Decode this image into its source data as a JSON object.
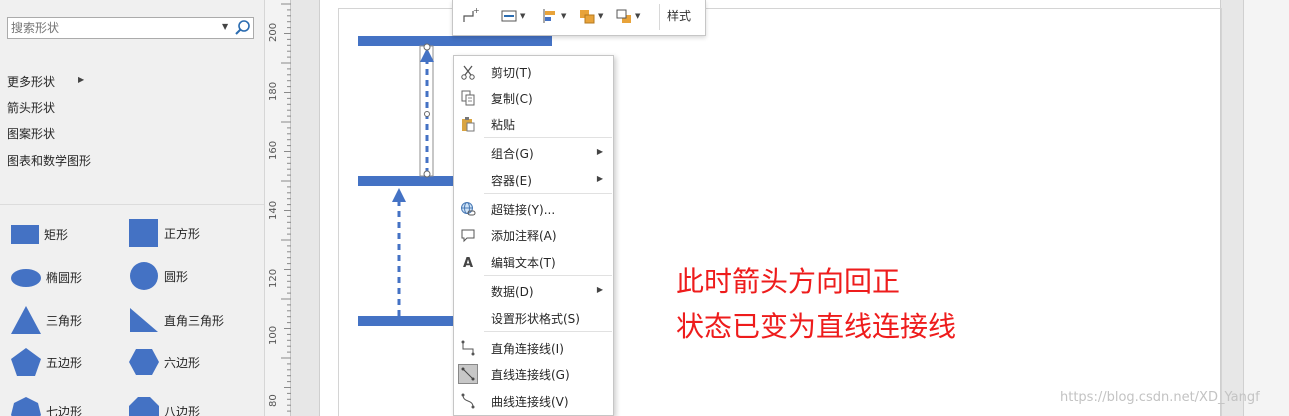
{
  "shapes_panel": {
    "search": {
      "placeholder": "搜索形状"
    },
    "categories": [
      "更多形状",
      "箭头形状",
      "图案形状",
      "图表和数学图形"
    ],
    "shapes": [
      "矩形",
      "正方形",
      "椭圆形",
      "圆形",
      "三角形",
      "直角三角形",
      "五边形",
      "六边形",
      "七边形",
      "八边形"
    ]
  },
  "ruler": {
    "labels": [
      "200",
      "180",
      "160",
      "140",
      "120",
      "100",
      "80"
    ]
  },
  "mini_toolbar": {
    "style_label": "样式"
  },
  "context_menu": {
    "items": [
      {
        "label": "剪切(T)",
        "icon": "scissors-icon"
      },
      {
        "label": "复制(C)",
        "icon": "copy-icon"
      },
      {
        "label": "粘贴",
        "icon": "paste-icon"
      },
      {
        "label": "组合(G)",
        "icon": "",
        "submenu": true
      },
      {
        "label": "容器(E)",
        "icon": "",
        "submenu": true
      },
      {
        "label": "超链接(Y)...",
        "icon": "hyperlink-icon"
      },
      {
        "label": "添加注释(A)",
        "icon": "comment-icon"
      },
      {
        "label": "编辑文本(T)",
        "icon": "text-icon"
      },
      {
        "label": "数据(D)",
        "icon": "",
        "submenu": true
      },
      {
        "label": "设置形状格式(S)",
        "icon": ""
      },
      {
        "label": "直角连接线(I)",
        "icon": "right-angle-connector-icon"
      },
      {
        "label": "直线连接线(G)",
        "icon": "straight-connector-icon",
        "selected": true
      },
      {
        "label": "曲线连接线(V)",
        "icon": "curved-connector-icon"
      }
    ]
  },
  "annotation": {
    "line1": "此时箭头方向回正",
    "line2": "状态已变为直线连接线"
  },
  "watermark": "https://blog.csdn.net/XD_Yangf",
  "colors": {
    "shape_blue": "#4472c4",
    "annotation_red": "#ee1c1c"
  }
}
